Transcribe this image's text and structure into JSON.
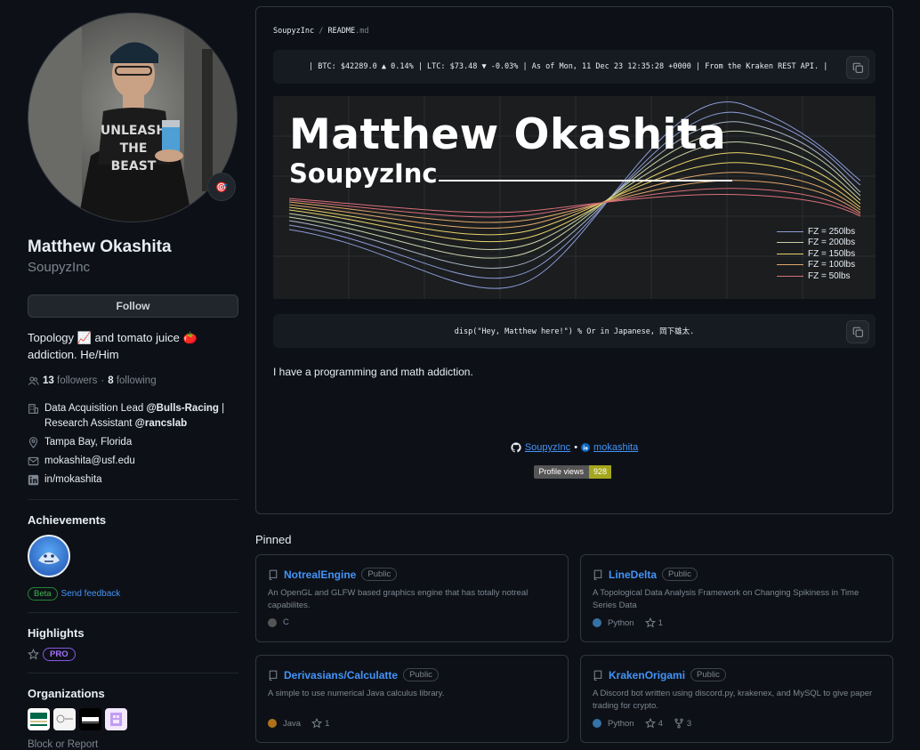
{
  "profile": {
    "name": "Matthew Okashita",
    "username": "SoupyzInc",
    "follow_label": "Follow",
    "bio_line1": "Topology 📈 and tomato juice 🍅",
    "bio_line2": "addiction. He/Him",
    "followers_count": "13",
    "followers_label": "followers",
    "following_count": "8",
    "following_label": "following",
    "dot": "·",
    "org_line1_prefix": "Data Acquisition Lead ",
    "org_line1_handle": "@Bulls-Racing",
    "org_line1_suffix": " |",
    "org_line2_prefix": "Research Assistant ",
    "org_line2_handle": "@rancslab",
    "location": "Tampa Bay, Florida",
    "email": "mokashita@usf.edu",
    "linkedin": "in/mokashita",
    "status_emoji": "🎯"
  },
  "achievements": {
    "title": "Achievements",
    "beta_label": "Beta",
    "feedback_label": "Send feedback"
  },
  "highlights": {
    "title": "Highlights",
    "pro_label": "PRO"
  },
  "organizations": {
    "title": "Organizations",
    "block_label": "Block or Report"
  },
  "readme": {
    "breadcrumb_user": "SoupyzInc",
    "breadcrumb_sep": "/",
    "breadcrumb_file": "README",
    "breadcrumb_ext": ".md",
    "ticker": "| BTC: $42289.0 ▲ 0.14% | LTC: $73.48 ▼ -0.03% | As of Mon, 11 Dec 23 12:35:28 +0000 | From the Kraken REST API. |",
    "banner_title": "Matthew Okashita",
    "banner_subtitle": "SoupyzInc",
    "legend": [
      {
        "label": "FZ = 250lbs",
        "color": "#8c9bd6"
      },
      {
        "label": "FZ = 200lbs",
        "color": "#c7d3a8"
      },
      {
        "label": "FZ = 150lbs",
        "color": "#e8d36a"
      },
      {
        "label": "FZ = 100lbs",
        "color": "#e0a86a"
      },
      {
        "label": "FZ = 50lbs",
        "color": "#d9707a"
      }
    ],
    "code_line": "disp(\"Hey, Matthew here!\")  % Or in Japanese, 岡下雄太.",
    "intro": "I have a programming and math addiction.",
    "social_github": "SoupyzInc",
    "social_sep": "•",
    "social_linkedin": "mokashita",
    "views_label": "Profile views",
    "views_count": "928"
  },
  "pinned": {
    "title": "Pinned",
    "repos": [
      {
        "name": "NotrealEngine",
        "visibility": "Public",
        "description": "An OpenGL and GLFW based graphics engine that has totally notreal capabilites.",
        "language": "C",
        "lang_color": "#555555",
        "stars": "",
        "forks": ""
      },
      {
        "name": "LineDelta",
        "visibility": "Public",
        "description": "A Topological Data Analysis Framework on Changing Spikiness in Time Series Data",
        "language": "Python",
        "lang_color": "#3572A5",
        "stars": "1",
        "forks": ""
      },
      {
        "name": "Derivasians/Calculatte",
        "visibility": "Public",
        "description": "A simple to use numerical Java calculus library.",
        "language": "Java",
        "lang_color": "#b07219",
        "stars": "1",
        "forks": ""
      },
      {
        "name": "KrakenOrigami",
        "visibility": "Public",
        "description": "A Discord bot written using discord.py, krakenex, and MySQL to give paper trading for crypto.",
        "language": "Python",
        "lang_color": "#3572A5",
        "stars": "4",
        "forks": "3"
      }
    ]
  }
}
